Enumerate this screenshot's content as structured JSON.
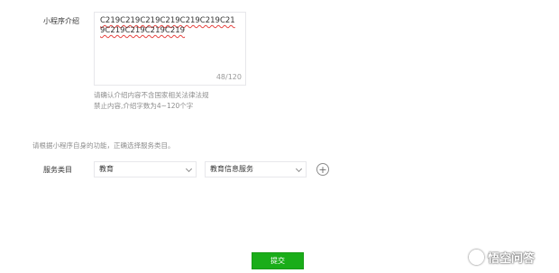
{
  "form": {
    "intro_label": "小程序介绍",
    "intro_value": "C219C219C219C219C219C219C219C219C219C219C219",
    "intro_count": "48/120",
    "intro_hint_line1": "请确认介绍内容不含国家相关法律法规",
    "intro_hint_line2": "禁止内容,介绍字数为4~120个字",
    "category_tip": "请根据小程序自身的功能，正确选择服务类目。",
    "category_label": "服务类目",
    "category_primary": "教育",
    "category_secondary": "教育信息服务",
    "submit_label": "提交"
  },
  "watermark": {
    "text": "悟空问答"
  },
  "colors": {
    "accent": "#1aad19",
    "border": "#e7e7eb",
    "hint": "#8d8d8d",
    "spellcheck": "#e64340"
  },
  "icons": {
    "add": "plus-circle-icon",
    "dropdown": "chevron-down-icon",
    "watermark_logo": "wukong-logo-icon"
  }
}
